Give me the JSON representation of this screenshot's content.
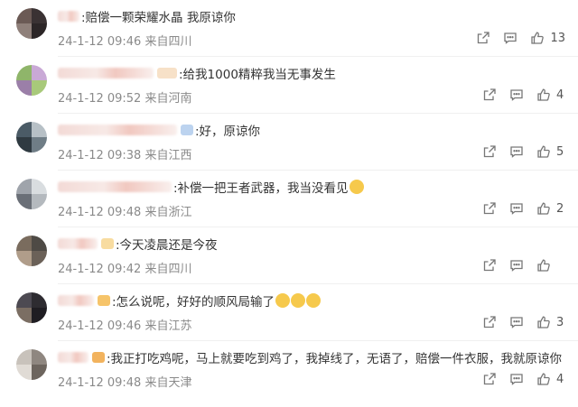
{
  "comments": [
    {
      "text": ":赔偿一颗荣耀水晶 我原谅你",
      "time": "24-1-12 09:46",
      "location": "来自四川",
      "likes": "13"
    },
    {
      "text": ":给我1000精粹我当无事发生",
      "time": "24-1-12 09:52",
      "location": "来自河南",
      "likes": "4"
    },
    {
      "text": ":好，原谅你",
      "time": "24-1-12 09:38",
      "location": "来自江西",
      "likes": "5"
    },
    {
      "text": ":补偿一把王者武器，我当没看见",
      "time": "24-1-12 09:48",
      "location": "来自浙江",
      "likes": "2"
    },
    {
      "text": ":今天凌晨还是今夜",
      "time": "24-1-12 09:42",
      "location": "来自四川",
      "likes": ""
    },
    {
      "text": ":怎么说呢，好好的顺风局输了",
      "time": "24-1-12 09:46",
      "location": "来自江苏",
      "likes": "3"
    },
    {
      "text": ":我正打吃鸡呢，马上就要吃到鸡了，我掉线了，无语了，赔偿一件衣服，我就原谅你",
      "time": "24-1-12 09:48",
      "location": "来自天津",
      "likes": "4"
    }
  ],
  "icons": {
    "repost": "repost-icon",
    "comment": "comment-icon",
    "like": "like-icon"
  },
  "colors": {
    "meta_text": "#8a8a8a",
    "name_blur": "#f3dad6",
    "emoji": "#f6c94c"
  }
}
